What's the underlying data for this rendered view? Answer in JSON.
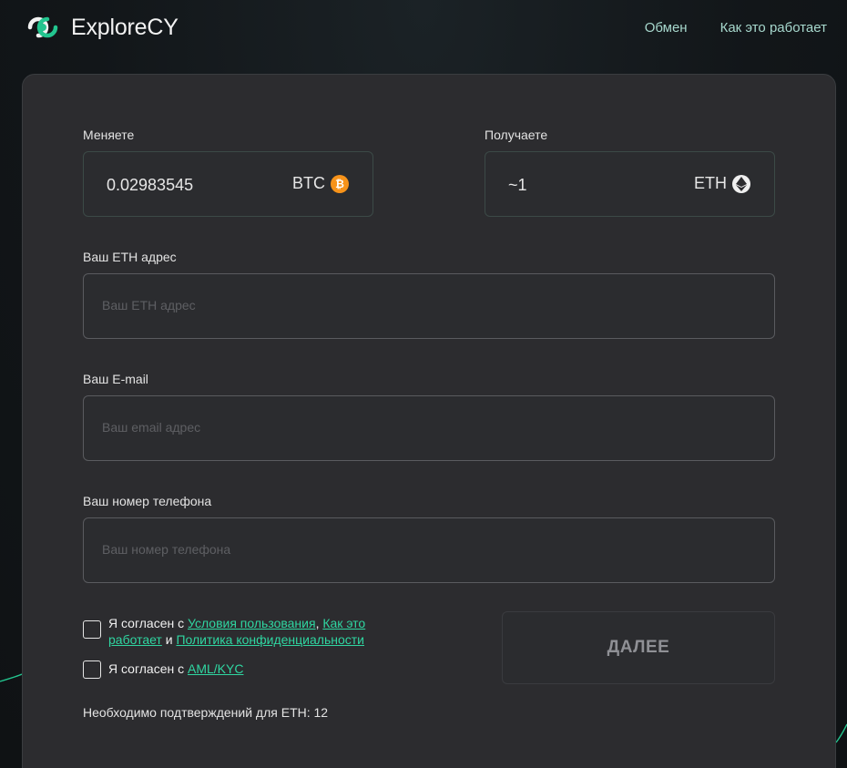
{
  "brand": {
    "name": "ExploreCY"
  },
  "nav": {
    "exchange": "Обмен",
    "how_it_works": "Как это работает"
  },
  "exchange": {
    "send_label": "Меняете",
    "send_amount": "0.02983545",
    "send_currency": "BTC",
    "receive_label": "Получаете",
    "receive_amount": "~1",
    "receive_currency": "ETH"
  },
  "form": {
    "eth_address_label": "Ваш ETH адрес",
    "eth_address_placeholder": "Ваш ETH адрес",
    "email_label": "Ваш E-mail",
    "email_placeholder": "Ваш email адрес",
    "phone_label": "Ваш номер телефона",
    "phone_placeholder": "Ваш номер телефона"
  },
  "agreements": {
    "terms_prefix": "Я согласен с ",
    "terms_link": "Условия пользования",
    "comma": ", ",
    "how_link": "Как это работает",
    "and": " и ",
    "privacy_link": "Политика конфиденциальности",
    "aml_prefix": "Я согласен с ",
    "aml_link": "AML/KYC"
  },
  "next_button": "ДАЛЕЕ",
  "confirmations_text": "Необходимо подтверждений для ETH: 12",
  "colors": {
    "accent": "#2fd6a1",
    "card_bg": "#2c2c2f",
    "btc": "#f7931a"
  },
  "icons": {
    "btc": "bitcoin-icon",
    "eth": "ethereum-icon",
    "logo": "explorecy-logo-icon"
  }
}
